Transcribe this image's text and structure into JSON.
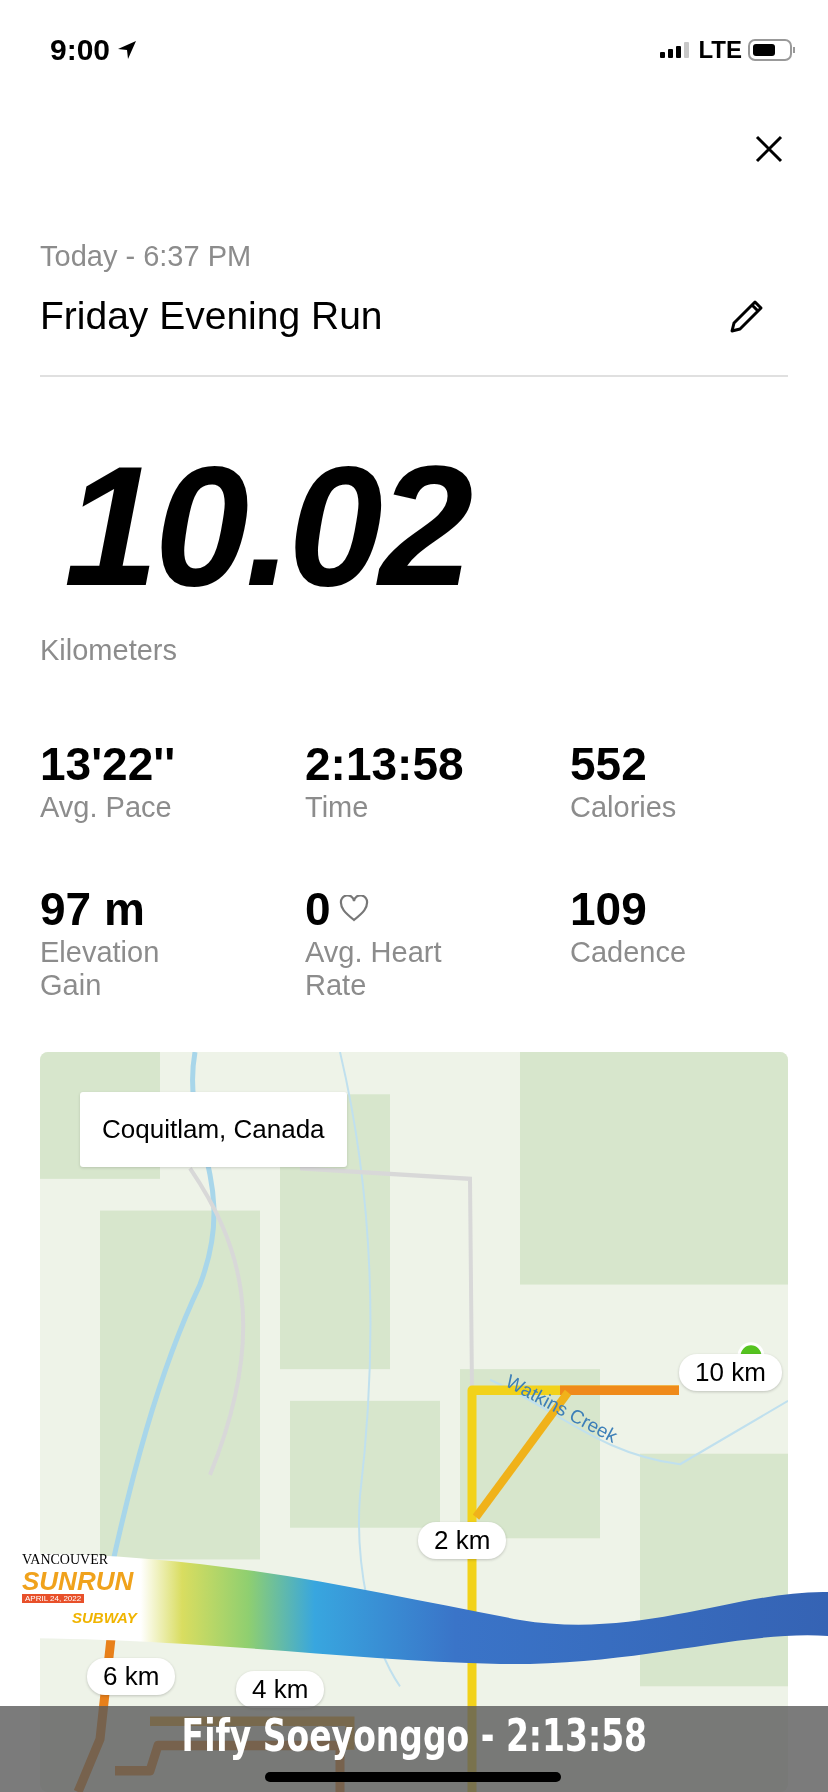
{
  "status_bar": {
    "time": "9:00",
    "network": "LTE"
  },
  "header": {
    "date": "Today - 6:37 PM",
    "title": "Friday Evening Run"
  },
  "distance": {
    "value": "10.02",
    "unit": "Kilometers"
  },
  "stats": [
    {
      "kind": "plain",
      "value": "13'22''",
      "label": "Avg. Pace"
    },
    {
      "kind": "plain",
      "value": "2:13:58",
      "label": "Time"
    },
    {
      "kind": "plain",
      "value": "552",
      "label": "Calories"
    },
    {
      "kind": "plain",
      "value": "97 m",
      "label": "Elevation Gain"
    },
    {
      "kind": "heart",
      "value": "0",
      "label": "Avg. Heart Rate"
    },
    {
      "kind": "plain",
      "value": "109",
      "label": "Cadence"
    }
  ],
  "map": {
    "location": "Coquitlam, Canada",
    "creek": "Watkins Creek",
    "markers": [
      {
        "label": "10 km"
      },
      {
        "label": "2 km"
      },
      {
        "label": "6 km"
      },
      {
        "label": "4 km"
      }
    ]
  },
  "overlay": {
    "logo_city": "VANCOUVER",
    "logo_event": "SUNRUN",
    "logo_date": "APRIL 24, 2022",
    "logo_sponsor": "SUBWAY",
    "caption": "Fify Soeyonggo - 2:13:58"
  }
}
